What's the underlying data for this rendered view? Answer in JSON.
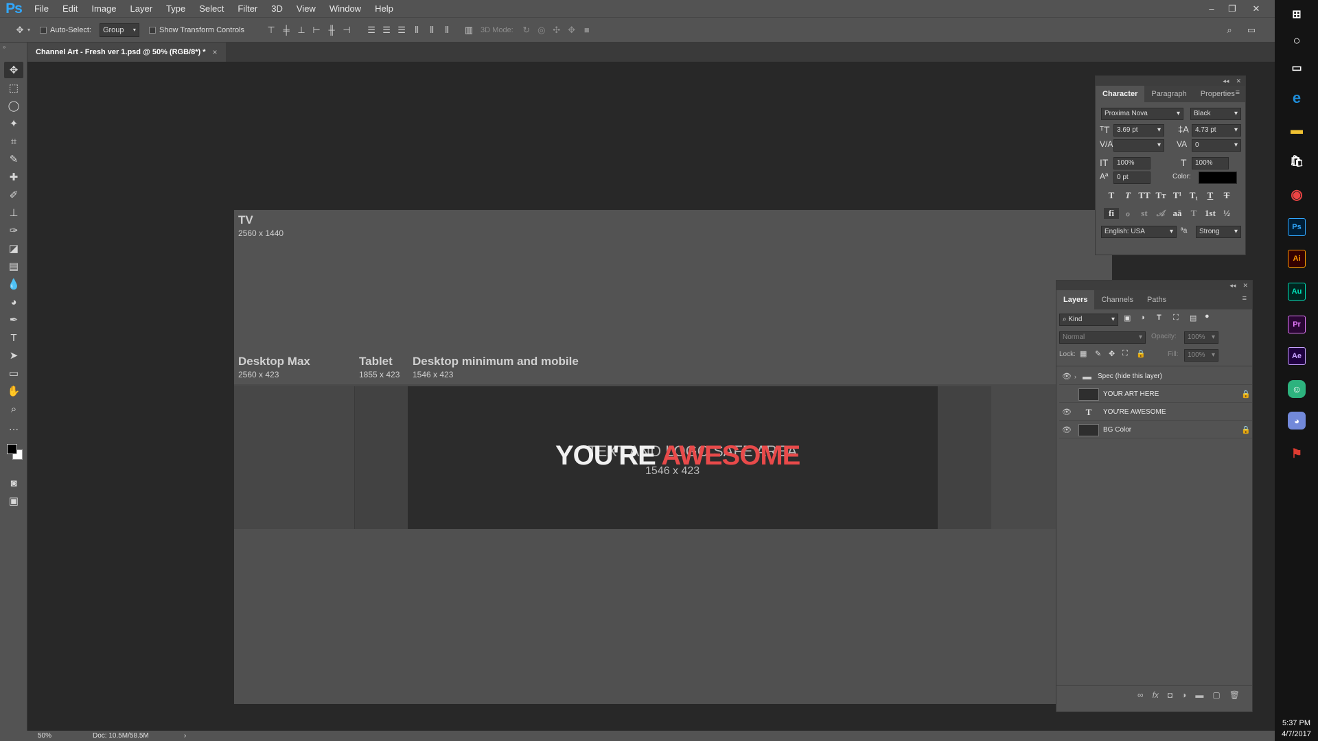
{
  "app": {
    "logo": "Ps",
    "menus": [
      "File",
      "Edit",
      "Image",
      "Layer",
      "Type",
      "Select",
      "Filter",
      "3D",
      "View",
      "Window",
      "Help"
    ]
  },
  "window_controls": {
    "minimize": "–",
    "restore": "❐",
    "close": "✕"
  },
  "options": {
    "auto_select_label": "Auto-Select:",
    "auto_select_value": "Group",
    "transform_label": "Show Transform Controls",
    "mode_label": "3D Mode:"
  },
  "document": {
    "tab_title": "Channel Art - Fresh ver 1.psd @ 50% (RGB/8*) *",
    "close": "×"
  },
  "canvas": {
    "tv_label": "TV",
    "tv_size": "2560 x 1440",
    "desktop_max_label": "Desktop Max",
    "desktop_max_size": "2560 x 423",
    "tablet_label": "Tablet",
    "tablet_size": "1855 x 423",
    "mobile_label": "Desktop minimum and mobile",
    "mobile_size": "1546 x 423",
    "safe_text": "TEXT AND LOGO SAFE AREA",
    "safe_size": "1546 x 423",
    "headline_white": "YOU'RE",
    "headline_red": "AWESOME",
    "headline_colors": {
      "white": "#f1f1f1",
      "red": "#e84a4a"
    }
  },
  "character_panel": {
    "tabs": [
      "Character",
      "Paragraph",
      "Properties"
    ],
    "font_family": "Proxima Nova",
    "font_style": "Black",
    "size": "3.69 pt",
    "leading": "4.73 pt",
    "kerning": "",
    "tracking": "0",
    "vscale": "100%",
    "hscale": "100%",
    "baseline": "0 pt",
    "color_label": "Color:",
    "color_value": "#000000",
    "style_row1": [
      "T",
      "T",
      "TT",
      "Tт",
      "T¹",
      "T₁",
      "T",
      "T"
    ],
    "style_row2": [
      "fi",
      "ℴ",
      "st",
      "𝒜",
      "aā",
      "T",
      "1st",
      "½"
    ],
    "language": "English: USA",
    "aa_icon": "ªa",
    "antialias": "Strong"
  },
  "layers_panel": {
    "tabs": [
      "Layers",
      "Channels",
      "Paths"
    ],
    "filter": "Kind",
    "blend_mode": "Normal",
    "opacity_label": "Opacity:",
    "opacity": "100%",
    "lock_label": "Lock:",
    "fill_label": "Fill:",
    "fill": "100%",
    "layers": [
      {
        "name": "Spec (hide this layer)",
        "visible": true,
        "type": "group"
      },
      {
        "name": "YOUR ART HERE",
        "visible": false,
        "type": "image",
        "locked": true
      },
      {
        "name": "YOU'RE AWESOME",
        "visible": true,
        "type": "text"
      },
      {
        "name": "BG Color",
        "visible": true,
        "type": "image",
        "locked": true
      }
    ]
  },
  "status": {
    "zoom": "50%",
    "doc": "Doc: 10.5M/58.5M",
    "arrow": "›"
  },
  "taskbar": {
    "time": "5:37 PM",
    "date": "4/7/2017"
  }
}
